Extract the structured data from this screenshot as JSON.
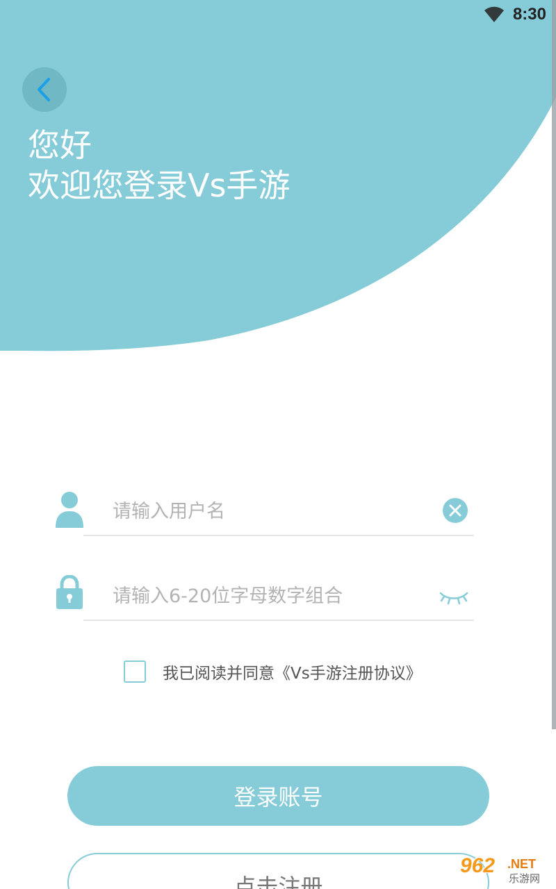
{
  "status_bar": {
    "time": "8:30",
    "wifi_icon": "wifi-icon"
  },
  "header": {
    "back_icon": "chevron-left-icon",
    "greeting_line1": "您好",
    "greeting_line2": "欢迎您登录Vs手游"
  },
  "form": {
    "username": {
      "icon": "user-icon",
      "placeholder": "请输入用户名",
      "value": "",
      "clear_icon": "clear-circle-icon"
    },
    "password": {
      "icon": "lock-icon",
      "placeholder": "请输入6-20位字母数字组合",
      "value": "",
      "toggle_icon": "eye-closed-icon"
    },
    "agreement": {
      "checked": false,
      "text_prefix": "我已阅读并同意",
      "link_text": "《Vs手游注册协议》"
    }
  },
  "buttons": {
    "login_label": "登录账号",
    "register_label": "点击注册"
  },
  "watermark": {
    "main": "962",
    "suffix": ".NET",
    "sub": "乐游网"
  },
  "colors": {
    "accent": "#86ccd8",
    "back_button": "#6fb8c4",
    "placeholder": "#b3b3b3"
  }
}
